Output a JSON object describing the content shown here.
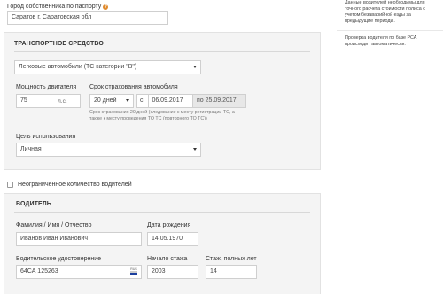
{
  "owner_city": {
    "label": "Город собственника по паспорту",
    "value": "Саратов г. Саратовская обл"
  },
  "vehicle": {
    "title": "ТРАНСПОРТНОЕ СРЕДСТВО",
    "category_value": "Легковые автомобили (ТС категории \"В\")",
    "power_label": "Мощность двигателя",
    "power_value": "75",
    "power_unit": "л.с.",
    "term_label": "Срок страхования автомобиля",
    "term_value": "20 дней",
    "from_prefix": "с",
    "date_from": "06.09.2017",
    "date_to": "по 25.09.2017",
    "term_help": "Срок страхования 20 дней (следование к месту регистрации ТС, а также к месту проведения ТО ТС (повторного ТО ТС))",
    "purpose_label": "Цель использования",
    "purpose_value": "Личная"
  },
  "unlimited_drivers": {
    "label": "Неограниченное количество водителей"
  },
  "driver": {
    "title": "ВОДИТЕЛЬ",
    "name_label": "Фамилия / Имя / Отчество",
    "name_value": "Иванов Иван Иванович",
    "birth_label": "Дата рождения",
    "birth_value": "14.05.1970",
    "license_label": "Водительское удостоверение",
    "license_value": "64СА 125263",
    "license_flag": "RUS",
    "exp_start_label": "Начало стажа",
    "exp_start_value": "2003",
    "exp_years_label": "Стаж, полных лет",
    "exp_years_value": "14"
  },
  "sidebar": {
    "note1": "Данные водителей необходимы для точного расчета стоимости полиса с учетом безаварийной езды за предыдущие периоды.",
    "note2": "Проверка водителя по базе РСА происходит автоматически."
  },
  "colors": {
    "panel_bg": "#f4f4f4",
    "info_icon": "#e08a2b"
  }
}
